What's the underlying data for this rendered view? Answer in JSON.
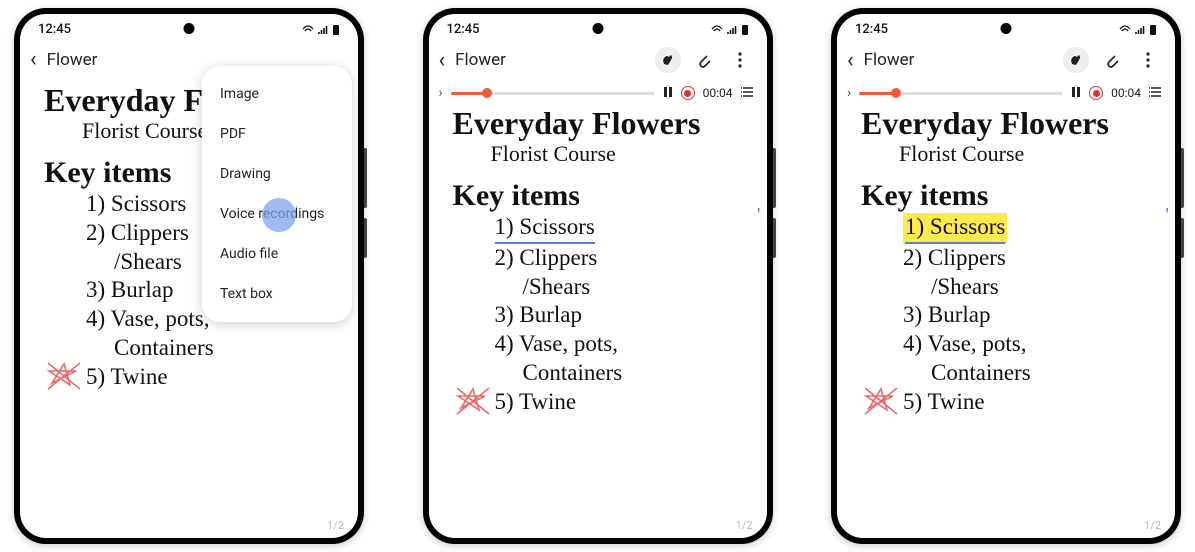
{
  "status": {
    "time": "12:45"
  },
  "header": {
    "back_label": "Flower"
  },
  "note": {
    "title_full": "Everyday Flowers",
    "title_cut": "Everyday Fl",
    "subtitle": "Florist Course",
    "section": "Key items",
    "items": [
      "1) Scissors",
      "2) Clippers",
      "/Shears",
      "3) Burlap",
      "4) Vase, pots,",
      "Containers",
      "5) Twine"
    ],
    "page_indicator": "1/2"
  },
  "menu": {
    "items": [
      "Image",
      "PDF",
      "Drawing",
      "Voice recordings",
      "Audio file",
      "Text box"
    ],
    "highlighted_index": 3
  },
  "recorder": {
    "time": "00:04"
  }
}
